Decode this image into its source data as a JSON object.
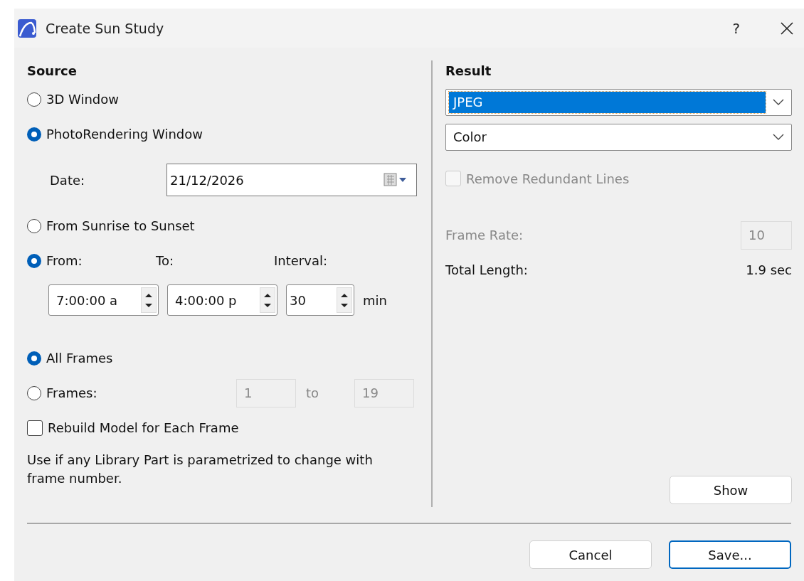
{
  "window": {
    "title": "Create Sun Study",
    "help": "?"
  },
  "source": {
    "heading": "Source",
    "options": [
      {
        "label": "3D Window",
        "selected": false
      },
      {
        "label": "PhotoRendering Window",
        "selected": true
      }
    ],
    "date": {
      "label": "Date:",
      "value": "21/12/2026"
    }
  },
  "time": {
    "options": [
      {
        "label": "From Sunrise to Sunset",
        "selected": false
      },
      {
        "label": "From:",
        "selected": true
      }
    ],
    "to_label": "To:",
    "interval_label": "Interval:",
    "from_value": "7:00:00 a",
    "to_value": "4:00:00 p",
    "interval_value": "30",
    "interval_unit": "min"
  },
  "frames": {
    "options": [
      {
        "label": "All Frames",
        "selected": true
      },
      {
        "label": "Frames:",
        "selected": false
      }
    ],
    "range_from": {
      "value": "1",
      "disabled": true
    },
    "range_separator": "to",
    "range_to": {
      "value": "19",
      "disabled": true
    }
  },
  "rebuild": {
    "label": "Rebuild Model for Each Frame",
    "checked": false
  },
  "note": "Use if any Library Part is parametrized to change with frame number.",
  "result": {
    "heading": "Result",
    "format": {
      "value": "JPEG",
      "focused": true
    },
    "color_mode": {
      "value": "Color",
      "focused": false
    },
    "remove_lines": {
      "label": "Remove Redundant Lines",
      "checked": false,
      "disabled": true
    },
    "frame_rate": {
      "label": "Frame Rate:",
      "value": "10",
      "disabled": true
    },
    "total_length": {
      "label": "Total Length:",
      "value": "1.9 sec"
    },
    "show_button": "Show"
  },
  "buttons": [
    {
      "label": "Cancel",
      "default": false
    },
    {
      "label": "Save...",
      "default": true
    }
  ]
}
